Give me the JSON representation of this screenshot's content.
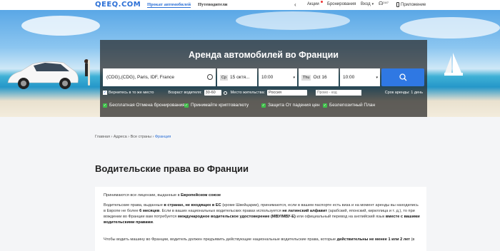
{
  "header": {
    "logo": "QEEQ.COM",
    "tabs": [
      "Прокат автомобилей",
      "Путеводители"
    ],
    "right": {
      "promos": "Акции",
      "bookings": "Бронирования",
      "login": "Вход",
      "support": "24/7",
      "app": "Приложение"
    }
  },
  "search": {
    "title": "Аренда автомобилей во Франции",
    "location_value": "(CDG),(CDG), Paris, IDF, France",
    "pickup_day": "Ср",
    "pickup_date": "15 октя...",
    "pickup_time": "10:00",
    "return_day": "Thu",
    "return_date": "Oct 16",
    "return_time": "10:00",
    "return_same_label": "Вернитесь в то же место",
    "driver_age_label": "Возраст водителя:",
    "driver_age_value": "30-60",
    "residence_label": "Место жительства:",
    "residence_value": "Россия",
    "promo_placeholder": "Промо - код",
    "duration": "Срок аренды: 1 день",
    "features": [
      "Бесплатная Отмена бронирования",
      "Принимайте криптовалюту",
      "Защита От падения цен",
      "Безлепозитный План"
    ]
  },
  "breadcrumb": {
    "home": "Главная",
    "addresses": "Адреса",
    "countries": "Все страны",
    "current": "Франция"
  },
  "page": {
    "title": "Водительские права во Франции",
    "p1_a": "Принимаются все лицензии, выданные в ",
    "p1_b": "Европейском союзе",
    "p2_a": "Водительские права, выданные ",
    "p2_b": "в странах, не входящих в ЕС",
    "p2_c": " (кроме Швейцарии), принимаются, если в вашем паспорте есть виза и на момент аренды вы находились в",
    "p2_d": "Европе не более ",
    "p2_e": "6 месяцев",
    "p2_f": ". Если в ваших национальных водительских правах используется ",
    "p2_g": "не латинский алфавит",
    "p2_h": " (арабский, японский, кириллица и т. д.), то при",
    "p2_i": "вождении во Франции вам потребуется ",
    "p2_j": "международное водительское удостоверение (МВУ/МВУ-E)",
    "p2_k": " или официальный перевод на английский язык ",
    "p2_l": "вместе с вашими",
    "p2_m": "водительскими правами",
    "p3_a": "Чтобы водить машину во Франции, водитель должен предъявить действующие национальные водительские права, которые ",
    "p3_b": "действительны не менее 1 или 2 лет",
    "p3_c": " (в"
  },
  "colors": {
    "accent": "#2a6fd6",
    "button": "#2f78e3",
    "check": "#3fbf4a"
  }
}
